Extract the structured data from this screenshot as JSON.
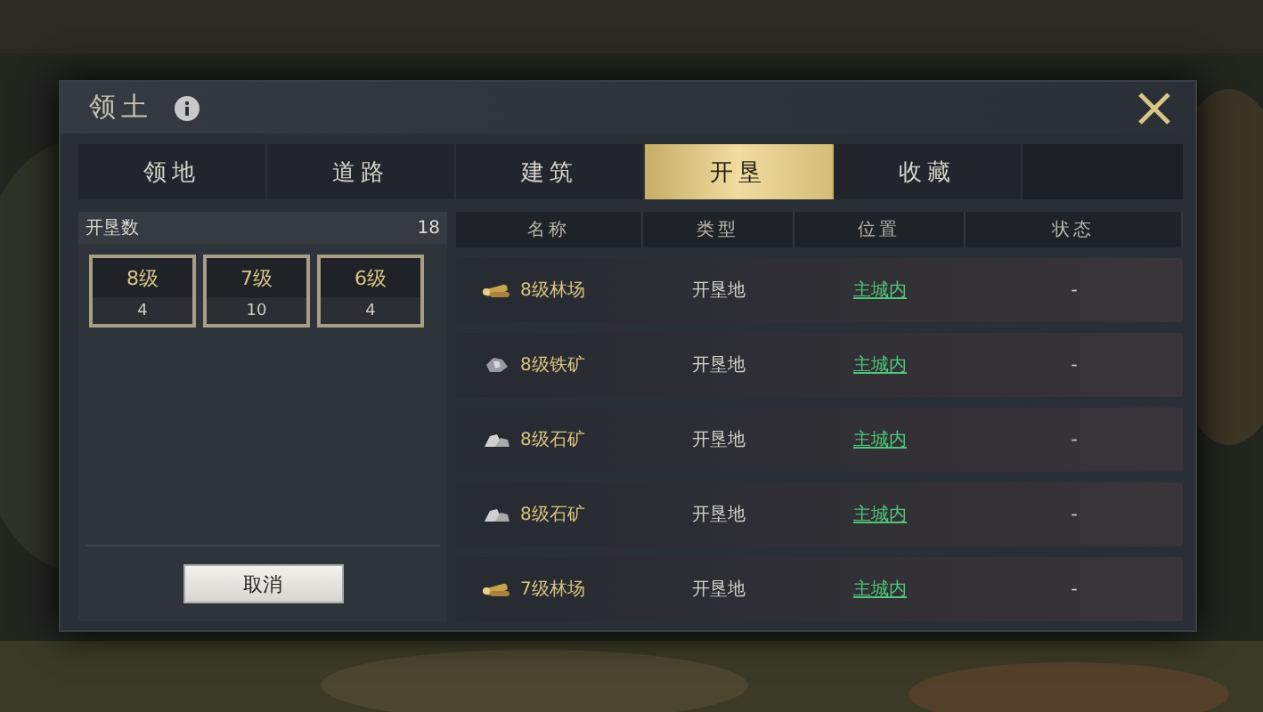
{
  "window": {
    "title": "领土"
  },
  "tabs": [
    {
      "label": "领地",
      "selected": false
    },
    {
      "label": "道路",
      "selected": false
    },
    {
      "label": "建筑",
      "selected": false
    },
    {
      "label": "开垦",
      "selected": true
    },
    {
      "label": "收藏",
      "selected": false
    }
  ],
  "summary": {
    "label": "开垦数",
    "total": "18",
    "levels": [
      {
        "level": "8级",
        "count": "4"
      },
      {
        "level": "7级",
        "count": "10"
      },
      {
        "level": "6级",
        "count": "4"
      }
    ],
    "cancel_button": "取消"
  },
  "table": {
    "columns": [
      "名称",
      "类型",
      "位置",
      "状态"
    ],
    "rows": [
      {
        "kind": "wood",
        "name": "8级林场",
        "type": "开垦地",
        "location": "主城内",
        "status": "-"
      },
      {
        "kind": "iron",
        "name": "8级铁矿",
        "type": "开垦地",
        "location": "主城内",
        "status": "-"
      },
      {
        "kind": "stone",
        "name": "8级石矿",
        "type": "开垦地",
        "location": "主城内",
        "status": "-"
      },
      {
        "kind": "stone",
        "name": "8级石矿",
        "type": "开垦地",
        "location": "主城内",
        "status": "-"
      },
      {
        "kind": "wood",
        "name": "7级林场",
        "type": "开垦地",
        "location": "主城内",
        "status": "-"
      }
    ]
  }
}
